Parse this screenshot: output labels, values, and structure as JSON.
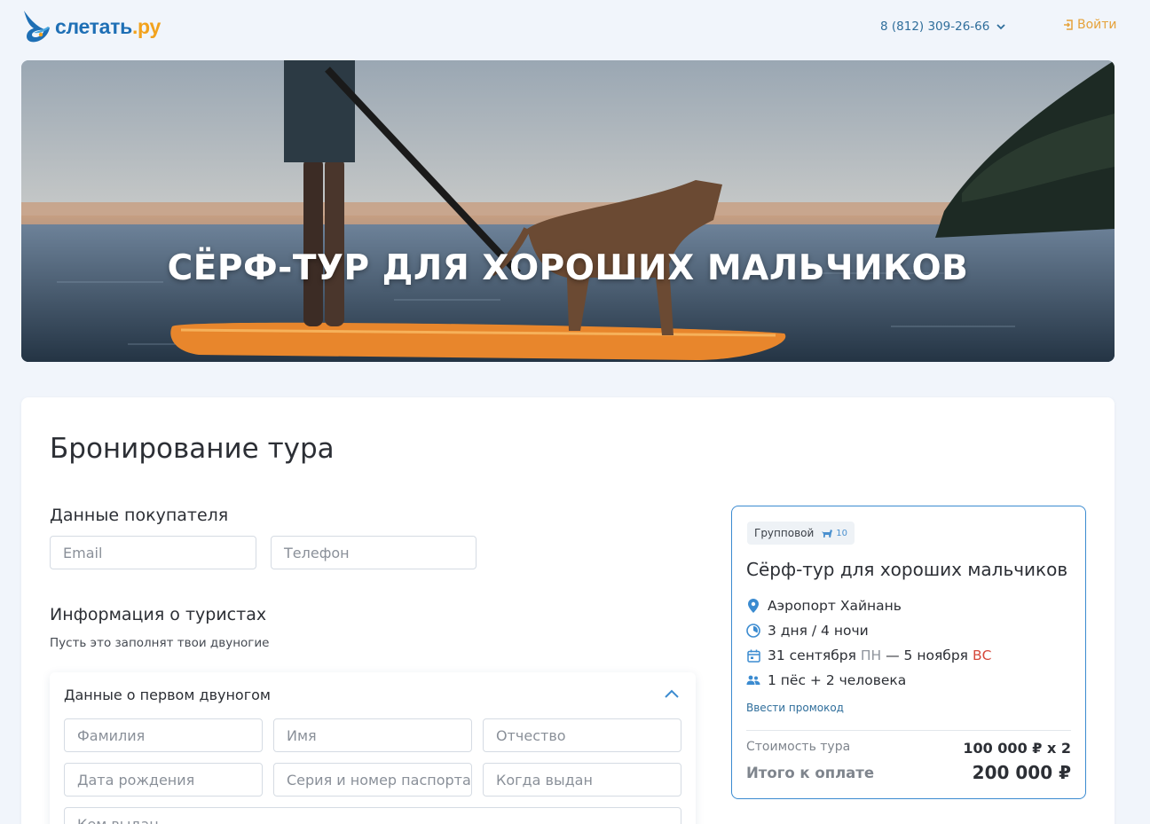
{
  "header": {
    "logo_main": "слетать",
    "logo_suffix": ".ру",
    "phone": "8 (812) 309-26-66",
    "login_label": "Войти"
  },
  "hero": {
    "title": "СЁРФ-ТУР ДЛЯ ХОРОШИХ МАЛЬЧИКОВ"
  },
  "booking": {
    "page_title": "Бронирование тура",
    "buyer": {
      "title": "Данные покупателя",
      "email_placeholder": "Email",
      "phone_placeholder": "Телефон"
    },
    "tourists": {
      "title": "Информация о туристах",
      "subtitle": "Пусть это заполнят твои двуногие",
      "panel_title": "Данные о первом двуногом",
      "fields": {
        "last_name": "Фамилия",
        "first_name": "Имя",
        "middle_name": "Отчество",
        "birth_date": "Дата рождения",
        "passport": "Серия и номер паспорта",
        "issued_date": "Когда выдан",
        "issued_by": "Кем выдан"
      }
    }
  },
  "summary": {
    "tag_label": "Групповой",
    "tag_count": "10",
    "tour_title": "Сёрф-тур для хороших мальчиков",
    "location": "Аэропорт Хайнань",
    "duration": "3 дня / 4 ночи",
    "date_start": "31 сентября",
    "date_start_dow": "ПН",
    "date_sep": "—",
    "date_end": "5 ноября",
    "date_end_dow": "ВС",
    "guests": "1 пёс + 2 человека",
    "promo_link": "Ввести промокод",
    "cost_label": "Стоимость тура",
    "cost_value": "100 000 ₽ x 2",
    "total_label": "Итого к оплате",
    "total_value": "200 000 ₽"
  },
  "colors": {
    "accent_blue": "#3b8bd0",
    "brand_orange": "#f2a21d",
    "weekend_red": "#d5483a",
    "page_bg": "#f1f5fb"
  },
  "icons": [
    "logo-bird-icon",
    "chevron-down-icon",
    "login-icon",
    "dog-icon",
    "location-pin-icon",
    "clock-icon",
    "calendar-icon",
    "people-icon",
    "chevron-up-icon"
  ]
}
